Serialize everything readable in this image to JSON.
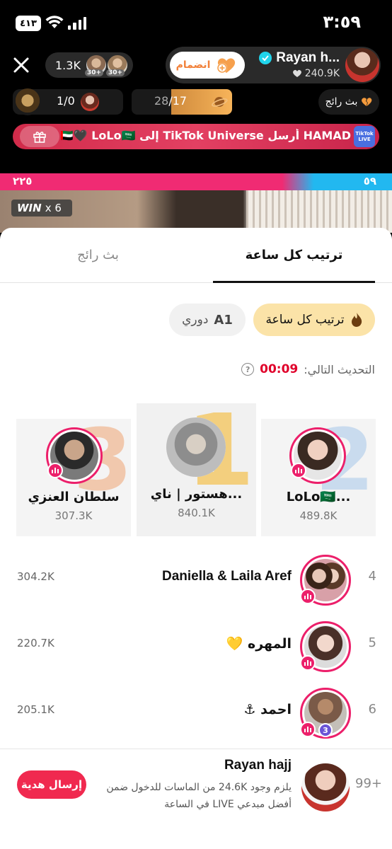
{
  "status": {
    "time": "٣:٥٩",
    "battery": "٤١٣"
  },
  "top_bar": {
    "viewer_count": "1.3K",
    "viewer_badge_1": "30+",
    "viewer_badge_2": "30+",
    "host_name": "Rayan h...",
    "host_likes": "240.9K",
    "join_label": "انضمام"
  },
  "second_row": {
    "rank_text": "1/0",
    "score_current": "17",
    "score_total": "28",
    "score_fraction": 0.607,
    "live_chip_label": "بث رائج"
  },
  "gift_banner": {
    "text": "HAMAD أرسل TikTok Universe إلى 🇦🇪🖤 LoLo🇸🇦",
    "badge_text": "TikTok LIVE"
  },
  "battle": {
    "left_score": "٢٢٥",
    "right_score": "٥٩",
    "win_label": "WIN",
    "win_mult": "x 6"
  },
  "tabs": {
    "hourly": "ترتيب كل ساعة",
    "rising": "بث رائج"
  },
  "filters": {
    "hourly": "ترتيب كل ساعة",
    "league_prefix": "دوري",
    "league_code": "A1"
  },
  "next_update": {
    "label": "التحديث التالي:",
    "countdown": "00:09",
    "help": "?"
  },
  "podium": [
    {
      "rank": "1",
      "name": "هستور | ناي...",
      "score": "840.1K"
    },
    {
      "rank": "2",
      "name": "LoLo🇸🇦...",
      "score": "489.8K"
    },
    {
      "rank": "3",
      "name": "سلطان العنزي",
      "score": "307.3K"
    }
  ],
  "ranking": [
    {
      "rank": "4",
      "name": "Daniella & Laila Aref",
      "score": "304.2K"
    },
    {
      "rank": "5",
      "name": "المهره 💛",
      "score": "220.7K"
    },
    {
      "rank": "6",
      "name": "احمد ⚓",
      "score": "205.1K",
      "level": "3"
    }
  ],
  "me": {
    "rank": "99+",
    "name": "Rayan hajj",
    "hint": "يلزم وجود 24.6K من الماسات للدخول ضمن أفضل مبدعي LIVE في الساعة",
    "send_gift": "إرسال هدية"
  },
  "colors": {
    "accent_pink": "#ec1f6a",
    "gift_red": "#f0294f",
    "countdown_red": "#e0002a",
    "chip_gold": "#fbe3a8"
  }
}
